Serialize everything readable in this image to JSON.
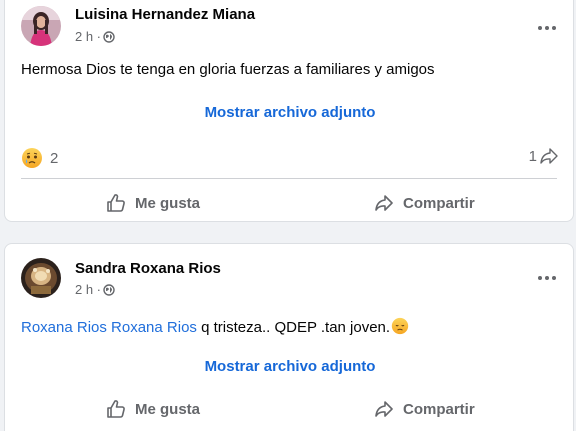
{
  "colors": {
    "page_background": "#f0f2f5",
    "card_background": "#ffffff",
    "link_blue": "#1668d8",
    "secondary_text": "#65676b"
  },
  "posts": [
    {
      "author": "Luisina Hernandez Miana",
      "time": "2 h ·",
      "privacy_icon": "globe-icon",
      "text": "Hermosa Dios te tenga en gloria fuerzas a familiares y amigos",
      "attachment_link": "Mostrar archivo adjunto",
      "reaction_icon": "sad-reaction-icon",
      "reaction_count": "2",
      "share_count": "1",
      "like_label": "Me gusta",
      "share_label": "Compartir"
    },
    {
      "author": "Sandra Roxana Rios",
      "time": "2 h ·",
      "privacy_icon": "globe-icon",
      "mention": "Roxana Rios Roxana Rios",
      "text": " q tristeza.. QDEP .tan joven.",
      "attachment_link": "Mostrar archivo adjunto",
      "like_label": "Me gusta",
      "share_label": "Compartir"
    }
  ]
}
